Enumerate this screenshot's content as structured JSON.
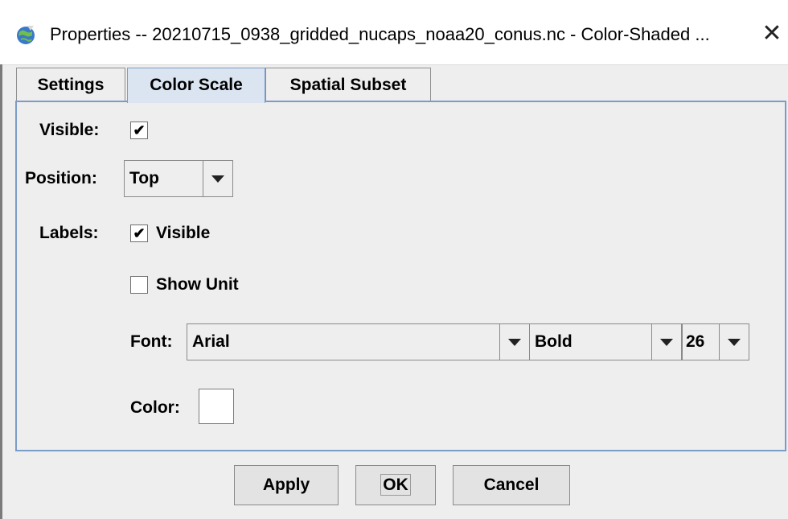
{
  "window": {
    "title": "Properties -- 20210715_0938_gridded_nucaps_noaa20_conus.nc - Color-Shaded ...",
    "app_icon": "globe-icon",
    "close_glyph": "✕"
  },
  "tabs": [
    {
      "label": "Settings",
      "active": false
    },
    {
      "label": "Color Scale",
      "active": true
    },
    {
      "label": "Spatial Subset",
      "active": false
    }
  ],
  "color_scale": {
    "visible_label": "Visible:",
    "visible_checked": true,
    "position_label": "Position:",
    "position_value": "Top",
    "labels_label": "Labels:",
    "labels_visible_text": "Visible",
    "labels_visible_checked": true,
    "show_unit_text": "Show Unit",
    "show_unit_checked": false,
    "font_label": "Font:",
    "font_family": "Arial",
    "font_style": "Bold",
    "font_size": "26",
    "color_label": "Color:",
    "color_value": "#ffffff"
  },
  "buttons": {
    "apply": "Apply",
    "ok": "OK",
    "cancel": "Cancel"
  },
  "check_glyph": "✔"
}
